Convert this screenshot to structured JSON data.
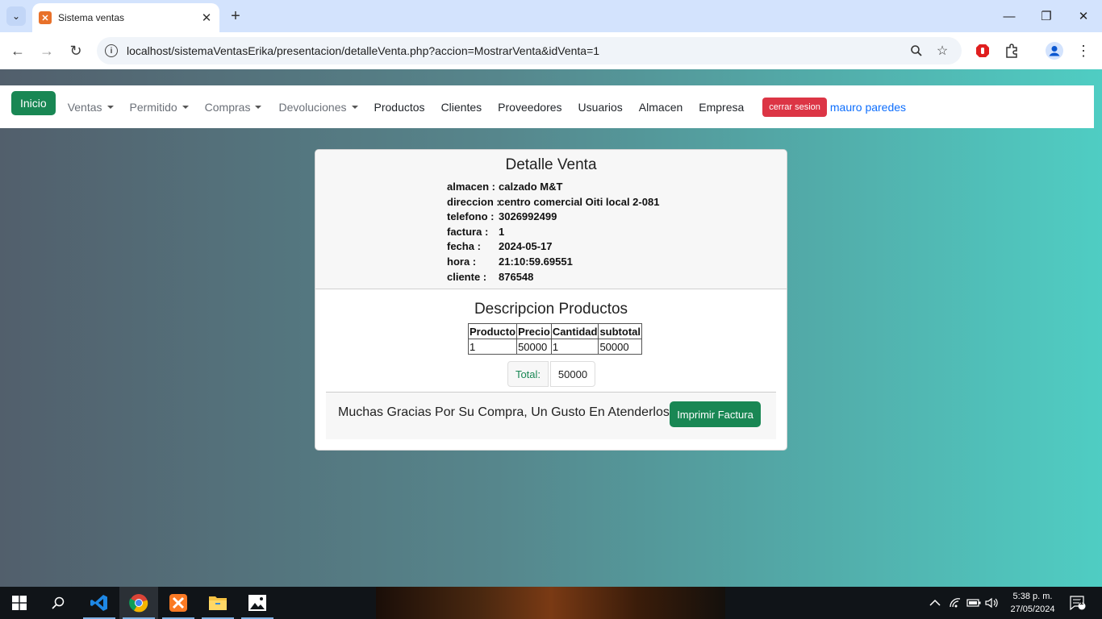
{
  "browser": {
    "tab_title": "Sistema ventas",
    "url": "localhost/sistemaVentasErika/presentacion/detalleVenta.php?accion=MostrarVenta&idVenta=1"
  },
  "navbar": {
    "inicio": "Inicio",
    "items": [
      {
        "label": "Ventas",
        "dropdown": true
      },
      {
        "label": "Permitido",
        "dropdown": true
      },
      {
        "label": "Compras",
        "dropdown": true
      },
      {
        "label": "Devoluciones",
        "dropdown": true
      },
      {
        "label": "Productos",
        "dropdown": false
      },
      {
        "label": "Clientes",
        "dropdown": false
      },
      {
        "label": "Proveedores",
        "dropdown": false
      },
      {
        "label": "Usuarios",
        "dropdown": false
      },
      {
        "label": "Almacen",
        "dropdown": false
      },
      {
        "label": "Empresa",
        "dropdown": false
      }
    ],
    "logout": "cerrar sesion",
    "user": "mauro paredes"
  },
  "detalle": {
    "title": "Detalle Venta",
    "rows": [
      {
        "label": "almacen :",
        "value": "calzado M&T"
      },
      {
        "label": "direccion :",
        "value": "centro comercial Oiti local 2-081"
      },
      {
        "label": "telefono :",
        "value": "3026992499"
      },
      {
        "label": "factura :",
        "value": "1"
      },
      {
        "label": "fecha :",
        "value": "2024-05-17"
      },
      {
        "label": "hora :",
        "value": "21:10:59.69551"
      },
      {
        "label": "cliente :",
        "value": "876548"
      }
    ]
  },
  "productos": {
    "title": "Descripcion Productos",
    "headers": [
      "Producto",
      "Precio",
      "Cantidad",
      "subtotal"
    ],
    "rows": [
      [
        "1",
        "50000",
        "1",
        "50000"
      ]
    ],
    "total_label": "Total:",
    "total_value": "50000"
  },
  "footer": {
    "thanks": "Muchas Gracias Por Su Compra, Un Gusto En Atenderlos",
    "print_button": "Imprimir Factura"
  },
  "taskbar": {
    "time": "5:38 p. m.",
    "date": "27/05/2024",
    "notification_count": "1"
  },
  "colors": {
    "success": "#198754",
    "danger": "#dc3545",
    "link": "#0d6efd"
  }
}
